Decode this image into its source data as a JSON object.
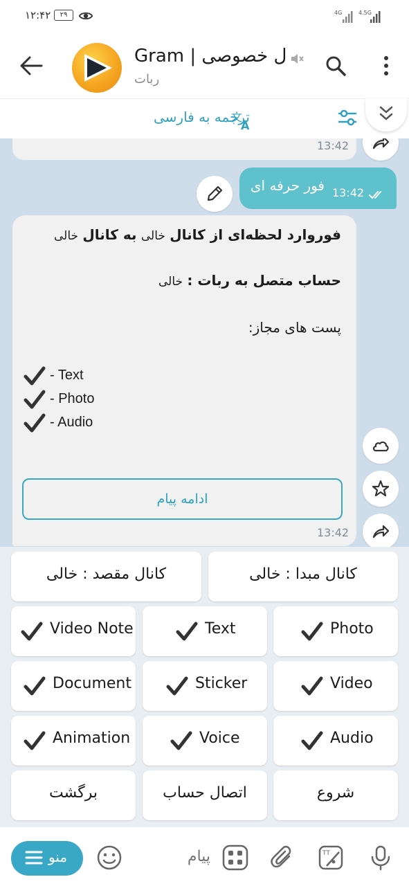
{
  "status_bar": {
    "time": "۱۲:۴۲",
    "badge": "۲۹",
    "net1": "4G",
    "net2": "4.5G"
  },
  "header": {
    "title": "Gram | ل خصوصی",
    "subtitle": "ربات"
  },
  "translate_bar": {
    "label": "ترجمه به فارسی"
  },
  "messages": {
    "prev_time": "13:42",
    "outgoing": {
      "text": "فور حرفه ای",
      "time": "13:42"
    },
    "bot": {
      "line1_bold": "فوروارد لحظه‌ای از کانال",
      "line1_val1": "خالی",
      "line1_bold2": "به کانال",
      "line1_val2": "خالی",
      "line2_bold": "حساب متصل به ربات :",
      "line2_val": "خالی",
      "line3": "پست های مجاز:",
      "allowed": [
        "- Text",
        "- Photo",
        "- Audio"
      ],
      "inline_button": "ادامه پیام",
      "time": "13:42"
    }
  },
  "keyboard": {
    "source_channel": "کانال مبدا : خالی",
    "dest_channel": "کانال مقصد : خالی",
    "rows": [
      [
        "Photo",
        "Text",
        "Video Note"
      ],
      [
        "Video",
        "Sticker",
        "Document"
      ],
      [
        "Audio",
        "Voice",
        "Animation"
      ]
    ],
    "start": "شروع",
    "connect_account": "اتصال حساب",
    "back": "برگشت"
  },
  "bottom_bar": {
    "menu_label": "منو",
    "input_placeholder": "پیام"
  },
  "colors": {
    "accent": "#2ea1c1",
    "outgoing_bubble": "#5ec1cc",
    "chat_bg": "#cfdcea"
  }
}
